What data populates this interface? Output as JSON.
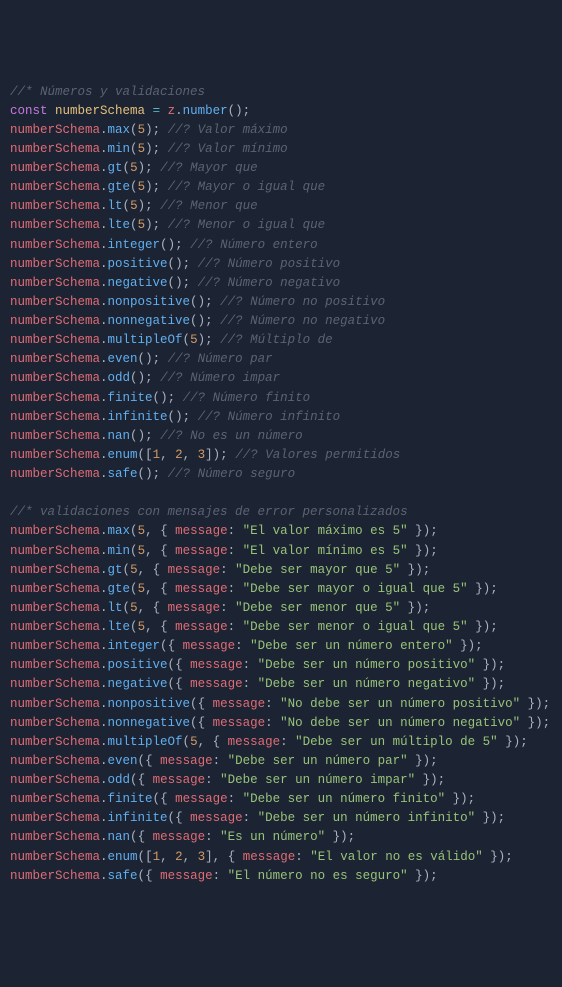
{
  "lines": [
    {
      "t": "comment",
      "text": "//* Números y validaciones"
    },
    {
      "t": "decl",
      "kw": "const",
      "name": "numberSchema",
      "eq": "=",
      "obj": "z",
      "method": "number",
      "args": []
    },
    {
      "t": "call",
      "obj": "numberSchema",
      "method": "max",
      "args": [
        "5"
      ],
      "comment": "//? Valor máximo"
    },
    {
      "t": "call",
      "obj": "numberSchema",
      "method": "min",
      "args": [
        "5"
      ],
      "comment": "//? Valor mínimo"
    },
    {
      "t": "call",
      "obj": "numberSchema",
      "method": "gt",
      "args": [
        "5"
      ],
      "comment": "//? Mayor que"
    },
    {
      "t": "call",
      "obj": "numberSchema",
      "method": "gte",
      "args": [
        "5"
      ],
      "comment": "//? Mayor o igual que"
    },
    {
      "t": "call",
      "obj": "numberSchema",
      "method": "lt",
      "args": [
        "5"
      ],
      "comment": "//? Menor que"
    },
    {
      "t": "call",
      "obj": "numberSchema",
      "method": "lte",
      "args": [
        "5"
      ],
      "comment": "//? Menor o igual que"
    },
    {
      "t": "call",
      "obj": "numberSchema",
      "method": "integer",
      "args": [],
      "comment": "//? Número entero"
    },
    {
      "t": "call",
      "obj": "numberSchema",
      "method": "positive",
      "args": [],
      "comment": "//? Número positivo"
    },
    {
      "t": "call",
      "obj": "numberSchema",
      "method": "negative",
      "args": [],
      "comment": "//? Número negativo"
    },
    {
      "t": "call",
      "obj": "numberSchema",
      "method": "nonpositive",
      "args": [],
      "comment": "//? Número no positivo"
    },
    {
      "t": "call",
      "obj": "numberSchema",
      "method": "nonnegative",
      "args": [],
      "comment": "//? Número no negativo"
    },
    {
      "t": "call",
      "obj": "numberSchema",
      "method": "multipleOf",
      "args": [
        "5"
      ],
      "comment": "//? Múltiplo de"
    },
    {
      "t": "call",
      "obj": "numberSchema",
      "method": "even",
      "args": [],
      "comment": "//? Número par"
    },
    {
      "t": "call",
      "obj": "numberSchema",
      "method": "odd",
      "args": [],
      "comment": "//? Número impar"
    },
    {
      "t": "call",
      "obj": "numberSchema",
      "method": "finite",
      "args": [],
      "comment": "//? Número finito"
    },
    {
      "t": "call",
      "obj": "numberSchema",
      "method": "infinite",
      "args": [],
      "comment": "//? Número infinito"
    },
    {
      "t": "call",
      "obj": "numberSchema",
      "method": "nan",
      "args": [],
      "comment": "//? No es un número"
    },
    {
      "t": "callarr",
      "obj": "numberSchema",
      "method": "enum",
      "arr": [
        "1",
        "2",
        "3"
      ],
      "comment": "//? Valores permitidos"
    },
    {
      "t": "call",
      "obj": "numberSchema",
      "method": "safe",
      "args": [],
      "comment": "//? Número seguro"
    },
    {
      "t": "blank"
    },
    {
      "t": "comment",
      "text": "//* validaciones con mensajes de error personalizados"
    },
    {
      "t": "callmsg",
      "obj": "numberSchema",
      "method": "max",
      "pre": "5",
      "msg": "\"El valor máximo es 5\""
    },
    {
      "t": "callmsg",
      "obj": "numberSchema",
      "method": "min",
      "pre": "5",
      "msg": "\"El valor mínimo es 5\""
    },
    {
      "t": "callmsg",
      "obj": "numberSchema",
      "method": "gt",
      "pre": "5",
      "msg": "\"Debe ser mayor que 5\""
    },
    {
      "t": "callmsg",
      "obj": "numberSchema",
      "method": "gte",
      "pre": "5",
      "msg": "\"Debe ser mayor o igual que 5\""
    },
    {
      "t": "callmsg",
      "obj": "numberSchema",
      "method": "lt",
      "pre": "5",
      "msg": "\"Debe ser menor que 5\""
    },
    {
      "t": "callmsg",
      "obj": "numberSchema",
      "method": "lte",
      "pre": "5",
      "msg": "\"Debe ser menor o igual que 5\""
    },
    {
      "t": "callmsg",
      "obj": "numberSchema",
      "method": "integer",
      "msg": "\"Debe ser un número entero\""
    },
    {
      "t": "callmsg",
      "obj": "numberSchema",
      "method": "positive",
      "msg": "\"Debe ser un número positivo\""
    },
    {
      "t": "callmsg",
      "obj": "numberSchema",
      "method": "negative",
      "msg": "\"Debe ser un número negativo\""
    },
    {
      "t": "callmsg",
      "obj": "numberSchema",
      "method": "nonpositive",
      "msg": "\"No debe ser un número positivo\""
    },
    {
      "t": "callmsg",
      "obj": "numberSchema",
      "method": "nonnegative",
      "msg": "\"No debe ser un número negativo\""
    },
    {
      "t": "callmsg",
      "obj": "numberSchema",
      "method": "multipleOf",
      "pre": "5",
      "msg": "\"Debe ser un múltiplo de 5\""
    },
    {
      "t": "callmsg",
      "obj": "numberSchema",
      "method": "even",
      "msg": "\"Debe ser un número par\""
    },
    {
      "t": "callmsg",
      "obj": "numberSchema",
      "method": "odd",
      "msg": "\"Debe ser un número impar\""
    },
    {
      "t": "callmsg",
      "obj": "numberSchema",
      "method": "finite",
      "msg": "\"Debe ser un número finito\""
    },
    {
      "t": "callmsg",
      "obj": "numberSchema",
      "method": "infinite",
      "msg": "\"Debe ser un número infinito\""
    },
    {
      "t": "callmsg",
      "obj": "numberSchema",
      "method": "nan",
      "msg": "\"Es un número\""
    },
    {
      "t": "callmsgarr",
      "obj": "numberSchema",
      "method": "enum",
      "arr": [
        "1",
        "2",
        "3"
      ],
      "msg": "\"El valor no es válido\""
    },
    {
      "t": "callmsg",
      "obj": "numberSchema",
      "method": "safe",
      "msg": "\"El número no es seguro\""
    }
  ]
}
